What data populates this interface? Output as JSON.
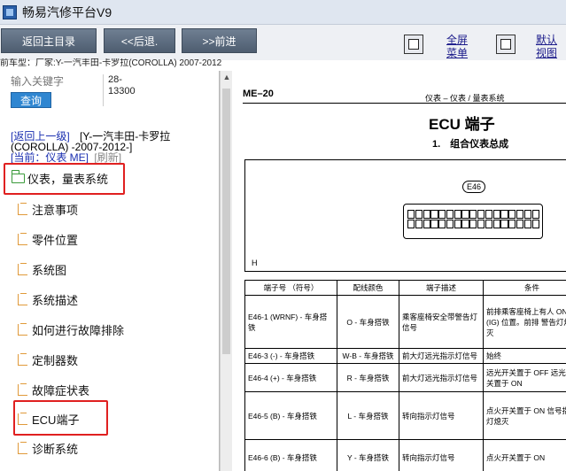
{
  "titlebar": {
    "title": "畅易汽修平台V9"
  },
  "toolbar": {
    "back_main": "返回主目录",
    "prev": "<<后退.",
    "next": ">>前进",
    "fullscreen_line1": "全屏",
    "fullscreen_line2": "菜单",
    "default_line1": "默认",
    "default_line2": "视图"
  },
  "vehicle": {
    "line": "前车型：厂家:Y-一汽丰田-卡罗拉(COROLLA) 2007-2012"
  },
  "search": {
    "placeholder": "输入关键字",
    "result_line1": "28-",
    "result_line2": "13300",
    "query_label": "查询"
  },
  "breadcrumb": {
    "back_link": "[返回上一级]",
    "path_line1": "[Y-一汽丰田-卡罗拉",
    "path_line2": "(COROLLA) -2007-2012-]",
    "current": "[当前：仪表 ME]",
    "refresh": "[刷新]"
  },
  "tree": {
    "folder": "仪表，量表系统",
    "items": [
      "注意事项",
      "零件位置",
      "系统图",
      "系统描述",
      "如何进行故障排除",
      "定制器数",
      "故障症状表",
      "ECU端子",
      "诊断系统"
    ]
  },
  "document": {
    "page_number": "ME–20",
    "header": "仪表 – 仪表 / 量表系统",
    "title": "ECU 端子",
    "subtitle": "1.　组合仪表总成",
    "connector_tag": "E46",
    "h_mark": "H",
    "table": {
      "headers": [
        "端子号 （符号）",
        "配线颜色",
        "端子描述",
        "条件"
      ],
      "rows": [
        {
          "terminal": "E46-1 (WRNF) - 车身搭铁",
          "color": "O - 车身搭铁",
          "desc": "乘客座椅安全带警告灯信号",
          "cond": "前排乘客座椅上有人 ON (IG) 位置。前排 警告灯熄灭"
        },
        {
          "terminal": "E46-3 (-) - 车身搭铁",
          "color": "W-B - 车身搭铁",
          "desc": "前大灯远光指示灯信号",
          "cond": "始终"
        },
        {
          "terminal": "E46-4 (+) - 车身搭铁",
          "color": "R - 车身搭铁",
          "desc": "前大灯远光指示灯信号",
          "cond": "远光开关置于 OFF 远光开关置于 ON"
        },
        {
          "terminal": "E46-5 (B) - 车身搭铁",
          "color": "L - 车身搭铁",
          "desc": "转向指示灯信号",
          "cond": "点火开关置于 ON 信号指示灯熄灭"
        },
        {
          "terminal": "E46-6 (B) - 车身搭铁",
          "color": "Y - 车身搭铁",
          "desc": "转向指示灯信号",
          "cond": "点火开关置于 ON"
        }
      ]
    }
  },
  "colors": {
    "query_button": "#2f86d1",
    "highlight": "#e02020",
    "toolbar_button": "#5a6a7e"
  }
}
